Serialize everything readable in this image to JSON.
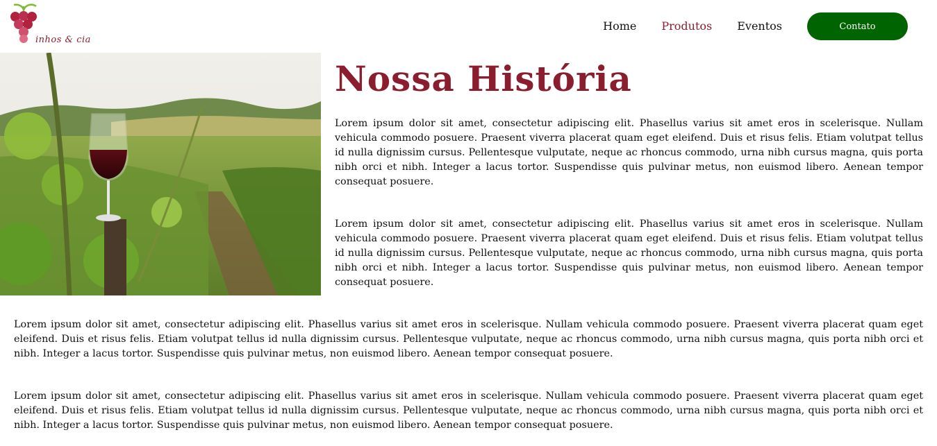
{
  "brand": {
    "logo_text": "inhos & cia",
    "icon": "grape-icon",
    "color": "#8a1e2e"
  },
  "nav": {
    "items": [
      {
        "label": "Home",
        "active": false
      },
      {
        "label": "Produtos",
        "active": true
      },
      {
        "label": "Eventos",
        "active": false
      }
    ],
    "contact_label": "Contato",
    "contact_color": "#006400"
  },
  "hero": {
    "image": "vineyard-wine-glass-photo"
  },
  "story": {
    "title": "Nossa História",
    "paragraphs": [
      "Lorem ipsum dolor sit amet, consectetur adipiscing elit. Phasellus varius sit amet eros in scelerisque. Nullam vehicula commodo posuere. Praesent viverra placerat quam eget eleifend. Duis et risus felis. Etiam volutpat tellus id nulla dignissim cursus. Pellentesque vulputate, neque ac rhoncus commodo, urna nibh cursus magna, quis porta nibh orci et nibh. Integer a lacus tortor. Suspendisse quis pulvinar metus, non euismod libero. Aenean tempor consequat posuere.",
      "Lorem ipsum dolor sit amet, consectetur adipiscing elit. Phasellus varius sit amet eros in scelerisque. Nullam vehicula commodo posuere. Praesent viverra placerat quam eget eleifend. Duis et risus felis. Etiam volutpat tellus id nulla dignissim cursus. Pellentesque vulputate, neque ac rhoncus commodo, urna nibh cursus magna, quis porta nibh orci et nibh. Integer a lacus tortor. Suspendisse quis pulvinar metus, non euismod libero. Aenean tempor consequat posuere.",
      "Lorem ipsum dolor sit amet, consectetur adipiscing elit. Phasellus varius sit amet eros in scelerisque. Nullam vehicula commodo posuere. Praesent viverra placerat quam eget eleifend. Duis et risus felis. Etiam volutpat tellus id nulla dignissim cursus. Pellentesque vulputate, neque ac rhoncus commodo, urna nibh cursus magna, quis porta nibh orci et nibh. Integer a lacus tortor. Suspendisse quis pulvinar metus, non euismod libero. Aenean tempor consequat posuere.",
      "Lorem ipsum dolor sit amet, consectetur adipiscing elit. Phasellus varius sit amet eros in scelerisque. Nullam vehicula commodo posuere. Praesent viverra placerat quam eget eleifend. Duis et risus felis. Etiam volutpat tellus id nulla dignissim cursus. Pellentesque vulputate, neque ac rhoncus commodo, urna nibh cursus magna, quis porta nibh orci et nibh. Integer a lacus tortor. Suspendisse quis pulvinar metus, non euismod libero. Aenean tempor consequat posuere."
    ]
  }
}
